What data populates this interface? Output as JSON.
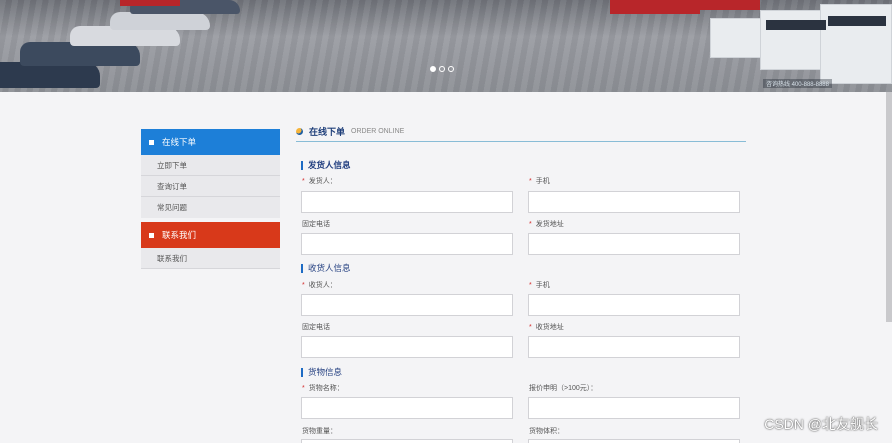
{
  "banner": {
    "caption": "咨询热线 400-888-8888",
    "carousel": {
      "count": 3,
      "active": 0
    }
  },
  "sidebar": {
    "section1": {
      "title": "在线下单",
      "items": [
        "立即下单",
        "查询订单",
        "常见问题"
      ]
    },
    "section2": {
      "title": "联系我们",
      "items": [
        "联系我们"
      ]
    }
  },
  "main": {
    "title": "在线下单",
    "title_en": "ORDER ONLINE"
  },
  "form": {
    "sender": {
      "title": "发货人信息",
      "name_label": "发货人：",
      "mobile_label": "手机",
      "phone_label": "固定电话",
      "address_label": "发货地址"
    },
    "receiver": {
      "title": "收货人信息",
      "name_label": "收货人：",
      "mobile_label": "手机",
      "phone_label": "固定电话",
      "address_label": "收货地址"
    },
    "goods": {
      "title": "货物信息",
      "name_label": "货物名称：",
      "value_label": "报价申明（>100元）：",
      "weight_label": "货物重量：",
      "volume_label": "货物体积："
    }
  },
  "watermark": "CSDN @北友舰长",
  "colors": {
    "accent_blue": "#1d7fd8",
    "accent_red": "#d8391a",
    "title_blue": "#233f80",
    "required": "#d42c2c"
  }
}
